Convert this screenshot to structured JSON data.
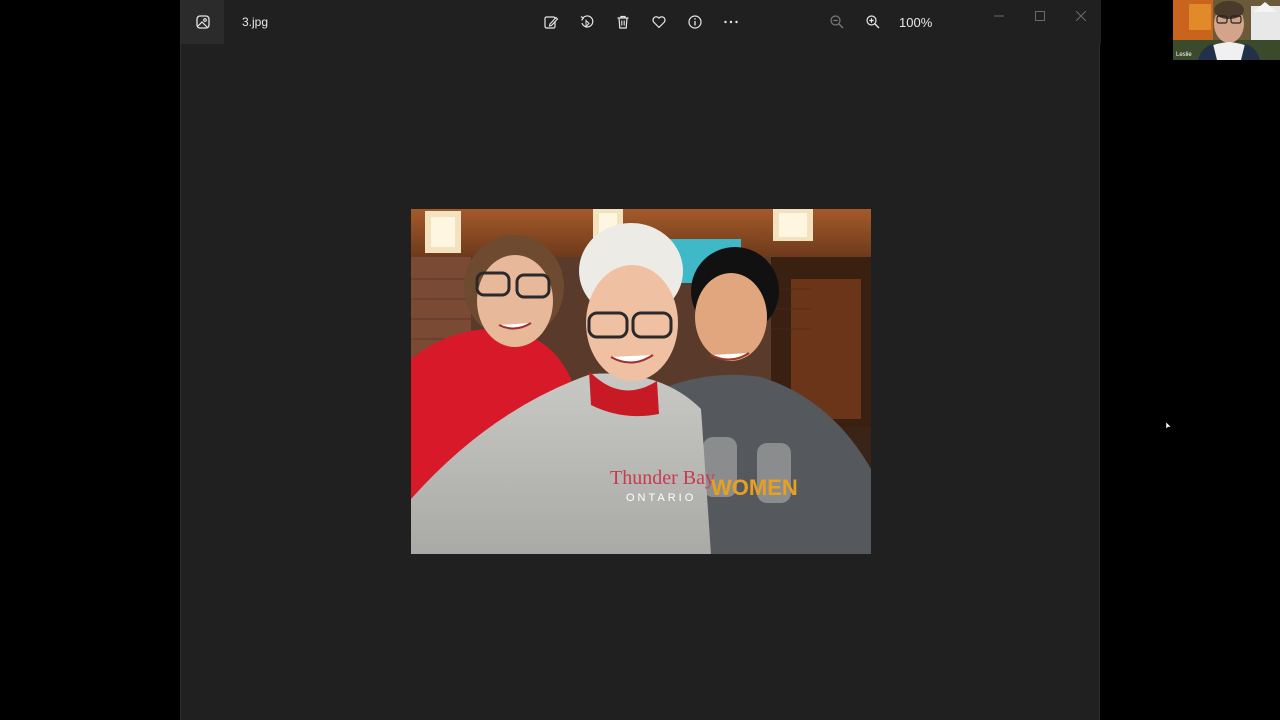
{
  "window": {
    "file_name": "3.jpg",
    "zoom_level": "100%"
  },
  "toolbar": {
    "items": [
      {
        "name": "edit-icon"
      },
      {
        "name": "rotate-icon"
      },
      {
        "name": "delete-icon"
      },
      {
        "name": "heart-icon"
      },
      {
        "name": "info-icon"
      },
      {
        "name": "more-icon"
      }
    ]
  },
  "photo": {
    "shirt_text_1": "Thunder Bay",
    "shirt_text_2": "ONTARIO",
    "shirt_text_3": "WOMEN"
  },
  "video_call": {
    "participant_name": "Leslie"
  },
  "colors": {
    "app_background": "#202020",
    "screen_background": "#000000",
    "text": "#e8e8e8"
  }
}
